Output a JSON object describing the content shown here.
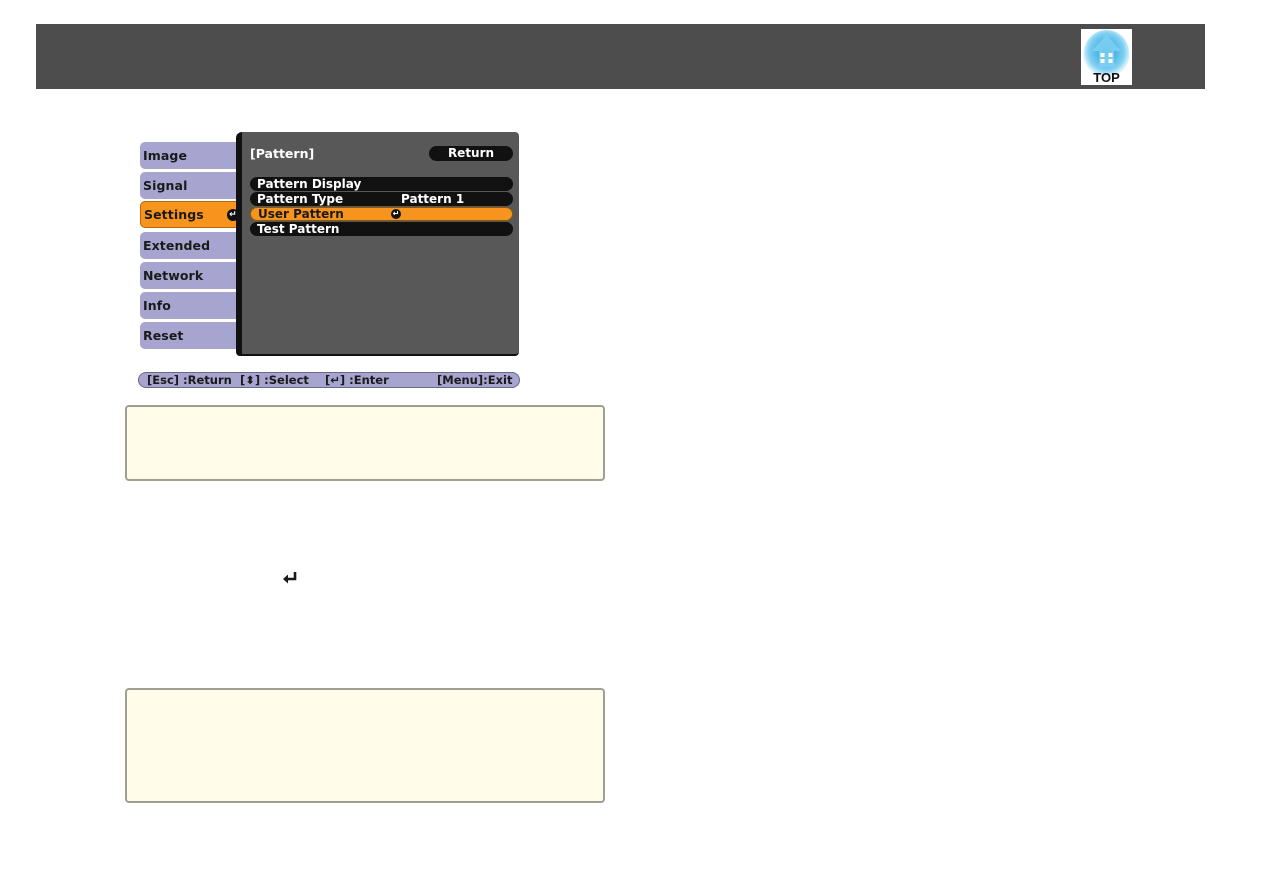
{
  "header": {
    "top_button": {
      "label": "TOP",
      "icon": "house-arrow-icon",
      "color": "#29a8e0"
    }
  },
  "menu_screenshot": {
    "tabs": [
      {
        "label": "Image",
        "active": false
      },
      {
        "label": "Signal",
        "active": false
      },
      {
        "label": "Settings",
        "active": true,
        "enter_icon": "↵"
      },
      {
        "label": "Extended",
        "active": false
      },
      {
        "label": "Network",
        "active": false
      },
      {
        "label": "Info",
        "active": false
      },
      {
        "label": "Reset",
        "active": false
      }
    ],
    "panel": {
      "title": "[Pattern]",
      "return_label": "Return",
      "rows": [
        {
          "label": "Pattern Display",
          "value": ""
        },
        {
          "label": "Pattern Type",
          "value": "Pattern 1"
        },
        {
          "label": "User Pattern",
          "value": "",
          "selected": true,
          "enter_icon": "↵"
        },
        {
          "label": "Test Pattern",
          "value": ""
        }
      ]
    },
    "help_bar": {
      "esc": "[Esc] :Return",
      "select": "[⬍] :Select",
      "enter": "[↵] :Enter",
      "exit": "[Menu]:Exit"
    },
    "colors": {
      "tab": "#a7a5cf",
      "active": "#f7941d",
      "panel": "#585858"
    }
  },
  "body": {
    "enter_key_glyph": "↵"
  },
  "notes": [
    {
      "text": ""
    },
    {
      "text": ""
    }
  ]
}
